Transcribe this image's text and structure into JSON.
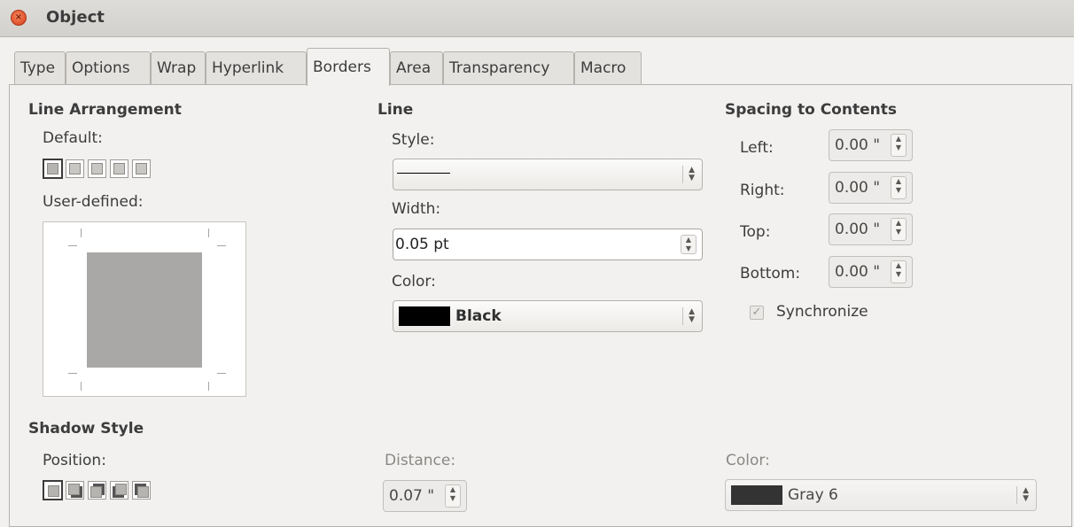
{
  "window": {
    "title": "Object",
    "close_glyph": "×"
  },
  "tabs": [
    {
      "label": "Type"
    },
    {
      "label": "Options"
    },
    {
      "label": "Wrap"
    },
    {
      "label": "Hyperlink"
    },
    {
      "label": "Borders"
    },
    {
      "label": "Area"
    },
    {
      "label": "Transparency"
    },
    {
      "label": "Macro"
    }
  ],
  "active_tab": "Borders",
  "line_arrangement": {
    "heading": "Line Arrangement",
    "default_label": "Default:",
    "user_defined_label": "User-defined:"
  },
  "line": {
    "heading": "Line",
    "style_label": "Style:",
    "width_label": "Width:",
    "width_value": "0.05 pt",
    "color_label": "Color:",
    "color_value": "Black",
    "color_swatch": "#000000"
  },
  "spacing": {
    "heading": "Spacing to Contents",
    "left_label": "Left:",
    "left_value": "0.00 \"",
    "right_label": "Right:",
    "right_value": "0.00 \"",
    "top_label": "Top:",
    "top_value": "0.00 \"",
    "bottom_label": "Bottom:",
    "bottom_value": "0.00 \"",
    "synchronize_label": "Synchronize",
    "synchronize_checked": true
  },
  "shadow": {
    "heading": "Shadow Style",
    "position_label": "Position:",
    "distance_label": "Distance:",
    "distance_value": "0.07 \"",
    "color_label": "Color:",
    "color_value": "Gray 6",
    "color_swatch": "#333333"
  },
  "icons": {
    "spin_up": "▲",
    "spin_down": "▼",
    "check": "✓"
  }
}
